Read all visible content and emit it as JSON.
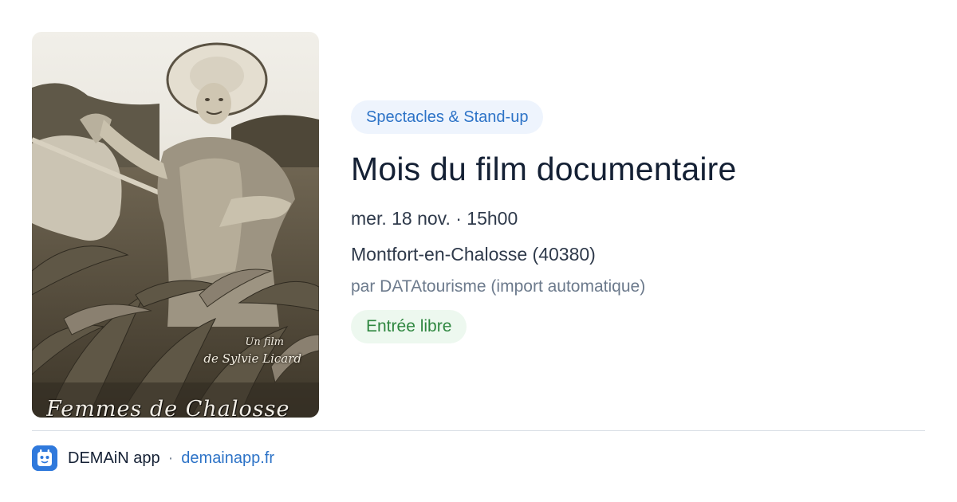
{
  "poster": {
    "credit_line1": "Un film",
    "credit_line2": "de Sylvie Licard",
    "film_title": "Femmes de Chalosse"
  },
  "event": {
    "category": "Spectacles & Stand-up",
    "title": "Mois du film documentaire",
    "datetime": "mer. 18 nov. · 15h00",
    "location": "Montfort-en-Chalosse (40380)",
    "source": "par DATAtourisme (import automatique)",
    "price": "Entrée libre"
  },
  "footer": {
    "app_name": "DEMAiN app",
    "separator": "·",
    "app_url": "demainapp.fr",
    "icon": "demain-app-icon"
  },
  "colors": {
    "category_bg": "#eef4fd",
    "category_text": "#2d73c7",
    "price_bg": "#edf8ef",
    "price_text": "#2f8740",
    "title_text": "#142034",
    "link": "#2d73c7",
    "app_icon_bg": "#2f79dc"
  }
}
